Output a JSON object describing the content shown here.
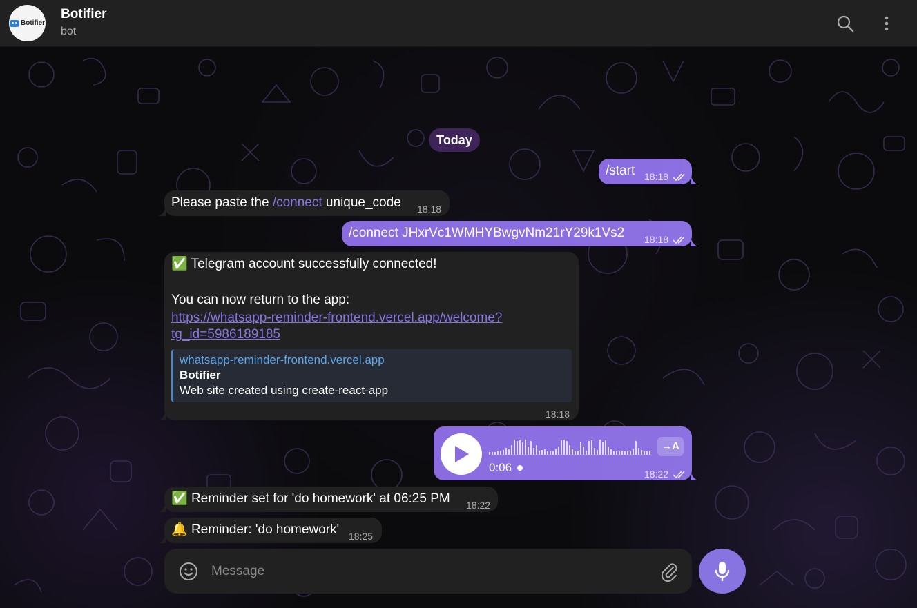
{
  "header": {
    "title": "Botifier",
    "subtitle": "bot",
    "avatar_text": "Botifier"
  },
  "chat": {
    "date_chip": "Today",
    "messages": [
      {
        "direction": "out",
        "text": "/start",
        "time": "18:18",
        "status": "read"
      },
      {
        "direction": "in",
        "text_before": "Please paste the ",
        "command": "/connect",
        "text_after": " unique_code",
        "time": "18:18"
      },
      {
        "direction": "out",
        "text": "/connect JHxrVc1WMHYBwgvNm21rY29k1Vs2",
        "time": "18:18",
        "status": "read"
      },
      {
        "direction": "in",
        "emoji": "✅",
        "line1": "Telegram account successfully connected!",
        "line2": "You can now return to the app:",
        "url_line1": "https://whatsapp-reminder-frontend.vercel.app/welcome?",
        "url_line2": "tg_id=5986189185",
        "preview": {
          "site": "whatsapp-reminder-frontend.vercel.app",
          "title": "Botifier",
          "description": "Web site created using create-react-app"
        },
        "time": "18:18"
      },
      {
        "direction": "out",
        "type": "voice",
        "duration": "0:06",
        "transcribe_label": "→A",
        "time": "18:22",
        "status": "read"
      },
      {
        "direction": "in",
        "emoji": "✅",
        "text": "Reminder set for 'do homework' at 06:25 PM",
        "time": "18:22"
      },
      {
        "direction": "in",
        "emoji": "🔔",
        "text": "Reminder: 'do homework'",
        "time": "18:25"
      }
    ]
  },
  "composer": {
    "placeholder": "Message"
  },
  "icons": {
    "search": "search-icon",
    "menu": "more-vertical-icon",
    "emoji": "smile-icon",
    "attach": "paperclip-icon",
    "mic": "microphone-icon",
    "play": "play-icon",
    "read": "double-check-icon"
  },
  "colors": {
    "accent": "#8774e1",
    "outgoing_bubble": "#8b6fe0",
    "incoming_bubble": "#212121",
    "header_bg": "#212121",
    "link": "#8774e1",
    "preview_site": "#5aa6ea"
  }
}
